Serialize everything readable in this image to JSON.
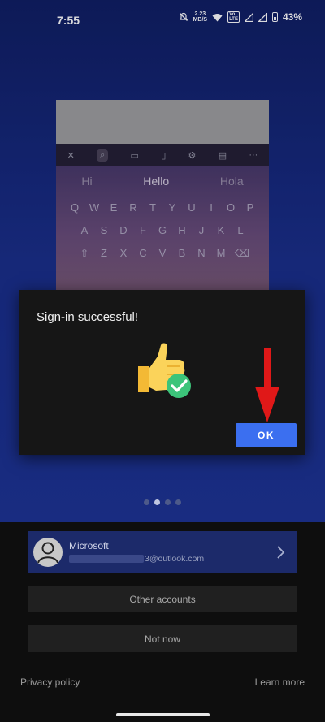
{
  "status_bar": {
    "time": "7:55",
    "net_speed_value": "2.23",
    "net_speed_unit": "MB/S",
    "volte_top": "Vo",
    "volte_bottom": "LTE",
    "battery": "43%"
  },
  "keyboard_preview": {
    "suggestions": [
      "Hi",
      "Hello",
      "Hola"
    ],
    "row1": [
      "Q",
      "W",
      "E",
      "R",
      "T",
      "Y",
      "U",
      "I",
      "O",
      "P"
    ],
    "row2": [
      "A",
      "S",
      "D",
      "F",
      "G",
      "H",
      "J",
      "K",
      "L"
    ],
    "row3": [
      "Z",
      "X",
      "C",
      "V",
      "B",
      "N",
      "M"
    ]
  },
  "dialog": {
    "title": "Sign-in successful!",
    "ok_label": "OK"
  },
  "pager": {
    "count": 4,
    "active_index": 1
  },
  "account": {
    "name": "Microsoft",
    "email_suffix": "3@outlook.com"
  },
  "buttons": {
    "other_accounts": "Other accounts",
    "not_now": "Not now"
  },
  "footer": {
    "privacy": "Privacy policy",
    "learn_more": "Learn more"
  },
  "colors": {
    "accent": "#3b6ff0",
    "annotation_arrow": "#e01818",
    "success_check": "#3cc47a"
  }
}
